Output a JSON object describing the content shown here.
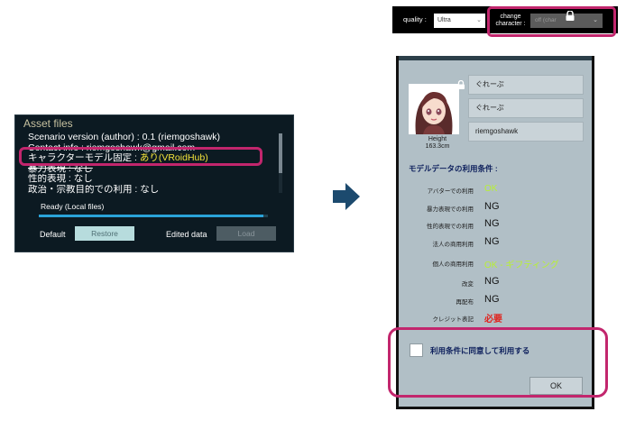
{
  "asset_panel": {
    "title": "Asset files",
    "lines": [
      "Scenario version (author) : 0.1 (riemgoshawk)",
      "Contact info : riemgoshawk@gmail.com",
      "キャラクターモデル固定 : ",
      "暴力表現 : なし",
      "性的表現 : なし",
      "政治・宗教目的での利用 : なし"
    ],
    "character_fixed_value": "あり(VRoidHub)",
    "status": "Ready (Local files)",
    "progress_fraction": 0.98,
    "default_label": "Default",
    "restore_button": "Restore",
    "edited_label": "Edited data",
    "load_button": "Load"
  },
  "arrow_icon": "arrow-right-icon",
  "top_bar": {
    "quality_label": "quality :",
    "quality_value": "Ultra",
    "change_character_label_1": "change",
    "change_character_label_2": "character :",
    "character_value": "off (char",
    "lock_icon": "lock-icon"
  },
  "model_dialog": {
    "height_label_1": "Height",
    "height_label_2": "163.3cm",
    "fields": [
      "ぐれーぷ",
      "ぐれーぷ",
      "riemgoshawk"
    ],
    "terms_heading": "モデルデータの利用条件 :",
    "terms": [
      {
        "label": "アバターでの利用",
        "value": "OK",
        "status": "ok"
      },
      {
        "label": "暴力表現での利用",
        "value": "NG",
        "status": "ng"
      },
      {
        "label": "性的表現での利用",
        "value": "NG",
        "status": "ng"
      },
      {
        "label": "法人の商用利用",
        "value": "NG",
        "status": "ng"
      },
      {
        "label": "個人の商用利用",
        "value": "OK - ギフティング",
        "status": "ok"
      },
      {
        "label": "改変",
        "value": "NG",
        "status": "ng"
      },
      {
        "label": "再配布",
        "value": "NG",
        "status": "ng"
      },
      {
        "label": "クレジット表記",
        "value": "必要",
        "status": "required"
      }
    ],
    "agree_label": "利用条件に同意して利用する",
    "agree_checked": false,
    "ok_button": "OK"
  },
  "colors": {
    "highlight": "#c2266d",
    "ok_green": "#b8f033",
    "required_red": "#e0241f",
    "heading_navy": "#0d1f5c",
    "arrow": "#1c4a6e"
  }
}
